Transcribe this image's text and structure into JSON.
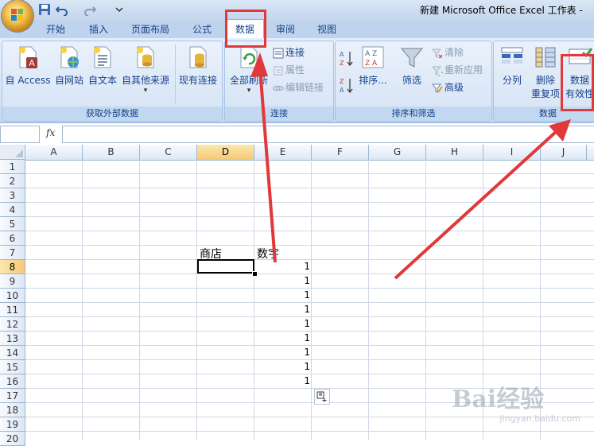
{
  "window": {
    "title": "新建 Microsoft Office Excel 工作表 - "
  },
  "tabs": [
    {
      "label": "开始"
    },
    {
      "label": "插入"
    },
    {
      "label": "页面布局"
    },
    {
      "label": "公式"
    },
    {
      "label": "数据",
      "active": true
    },
    {
      "label": "审阅"
    },
    {
      "label": "视图"
    }
  ],
  "ribbon": {
    "get_external": {
      "label": "获取外部数据",
      "buttons": [
        "自 Access",
        "自网站",
        "自文本",
        "自其他来源",
        "现有连接"
      ]
    },
    "connections": {
      "label": "连接",
      "refresh_all": "全部刷新",
      "connections": "连接",
      "properties": "属性",
      "edit_links": "编辑链接"
    },
    "sort_filter": {
      "label": "排序和筛选",
      "sort": "排序...",
      "filter": "筛选",
      "clear": "清除",
      "reapply": "重新应用",
      "advanced": "高级"
    },
    "data_tools": {
      "label": "数据",
      "text_to_columns": "分列",
      "remove_dup_1": "删除",
      "remove_dup_2": "重复项",
      "validation_1": "数据",
      "validation_2": "有效性"
    }
  },
  "formula_bar": {
    "fx": "fx",
    "content": ""
  },
  "columns": [
    "A",
    "B",
    "C",
    "D",
    "E",
    "F",
    "G",
    "H",
    "I",
    "J"
  ],
  "rows": [
    "1",
    "2",
    "3",
    "4",
    "5",
    "6",
    "7",
    "8",
    "9",
    "10",
    "11",
    "12",
    "13",
    "14",
    "15",
    "16",
    "17",
    "18",
    "19",
    "20"
  ],
  "selected_col": "D",
  "selected_row": "8",
  "cells": {
    "D7": "商店",
    "E7": "数字",
    "E8": "1",
    "E9": "1",
    "E10": "1",
    "E11": "1",
    "E12": "1",
    "E13": "1",
    "E14": "1",
    "E15": "1",
    "E16": "1"
  },
  "watermark": {
    "brand": "Bai经验",
    "url": "jingyan.baidu.com"
  },
  "colors": {
    "accent": "#15428b",
    "annotation": "#e0393a"
  }
}
